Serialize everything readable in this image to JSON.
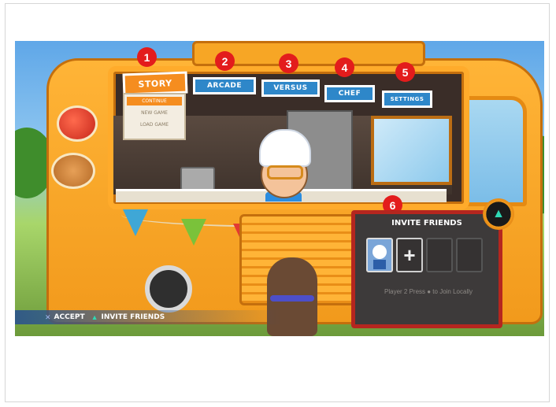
{
  "menu": {
    "tabs": [
      {
        "label": "STORY",
        "badge": "1"
      },
      {
        "label": "ARCADE",
        "badge": "2"
      },
      {
        "label": "VERSUS",
        "badge": "3"
      },
      {
        "label": "CHEF",
        "badge": "4"
      },
      {
        "label": "SETTINGS",
        "badge": "5"
      }
    ],
    "story_options": [
      "CONTINUE",
      "NEW GAME",
      "LOAD GAME"
    ],
    "selected_option": "CONTINUE"
  },
  "invite_panel": {
    "badge": "6",
    "title": "INVITE FRIENDS",
    "add_slot_symbol": "+",
    "note": "Player 2 Press ● to Join Locally"
  },
  "prompts": {
    "accept_label": "ACCEPT",
    "invite_label": "INVITE FRIENDS",
    "accept_icon": "cross-button-icon",
    "invite_icon": "triangle-button-icon"
  },
  "colors": {
    "badge": "#e31c1c",
    "tab_blue": "#2e87c9",
    "tab_active": "#f58d1f",
    "truck_orange": "#f29a1c",
    "panel_border": "#b5261f"
  }
}
